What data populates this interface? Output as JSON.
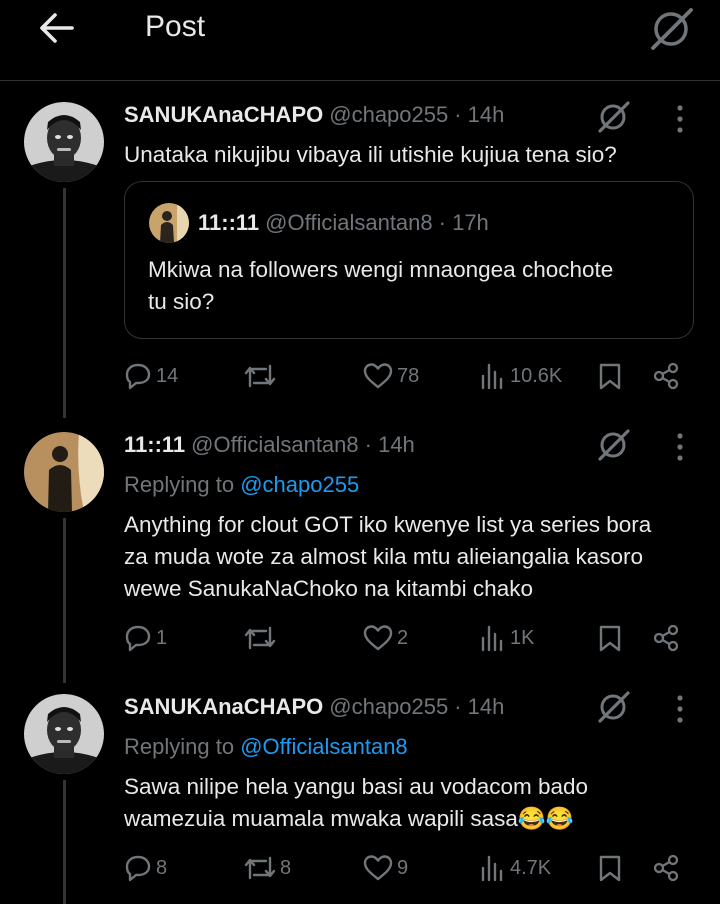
{
  "header": {
    "title": "Post"
  },
  "posts": [
    {
      "name": "SANUKAnaCHAPO",
      "handle": "@chapo255",
      "time": "· 14h",
      "text": "Unataka nikujibu vibaya ili utishie kujiua tena sio?",
      "quote": {
        "name": "11::11",
        "handle": "@Officialsantan8",
        "time": "· 17h",
        "text_line1": "Mkiwa na followers wengi mnaongea chochote",
        "text_line2": "tu sio?"
      },
      "actions": {
        "replies": "14",
        "reposts": "",
        "likes": "78",
        "views": "10.6K"
      }
    },
    {
      "name": "11::11",
      "handle": "@Officialsantan8",
      "time": "· 14h",
      "replying_prefix": "Replying to",
      "replying_handle": "@chapo255",
      "text_line1": "Anything for clout GOT iko kwenye list ya series bora",
      "text_line2": "za muda wote za almost kila mtu alieiangalia kasoro",
      "text_line3": "wewe SanukaNaChoko na kitambi chako",
      "actions": {
        "replies": "1",
        "reposts": "",
        "likes": "2",
        "views": "1K"
      }
    },
    {
      "name": "SANUKAnaCHAPO",
      "handle": "@chapo255",
      "time": "· 14h",
      "replying_prefix": "Replying to",
      "replying_handle": "@Officialsantan8",
      "text_line1": "Sawa nilipe hela yangu basi au vodacom bado",
      "text_line2": "wamezuia muamala mwaka wapili sasa",
      "emoji": "😂😂",
      "actions": {
        "replies": "8",
        "reposts": "8",
        "likes": "9",
        "views": "4.7K"
      }
    }
  ],
  "icons": {
    "back": "arrow-left-icon",
    "grok": "grok-icon",
    "more": "more-vertical-icon",
    "reply": "reply-icon",
    "repost": "repost-icon",
    "like": "heart-icon",
    "views": "views-icon",
    "bookmark": "bookmark-icon",
    "share": "share-icon"
  },
  "colors": {
    "background": "#000000",
    "text": "#e7e9ea",
    "muted": "#71767b",
    "link": "#1d9bf0",
    "divider": "#2f3336"
  }
}
